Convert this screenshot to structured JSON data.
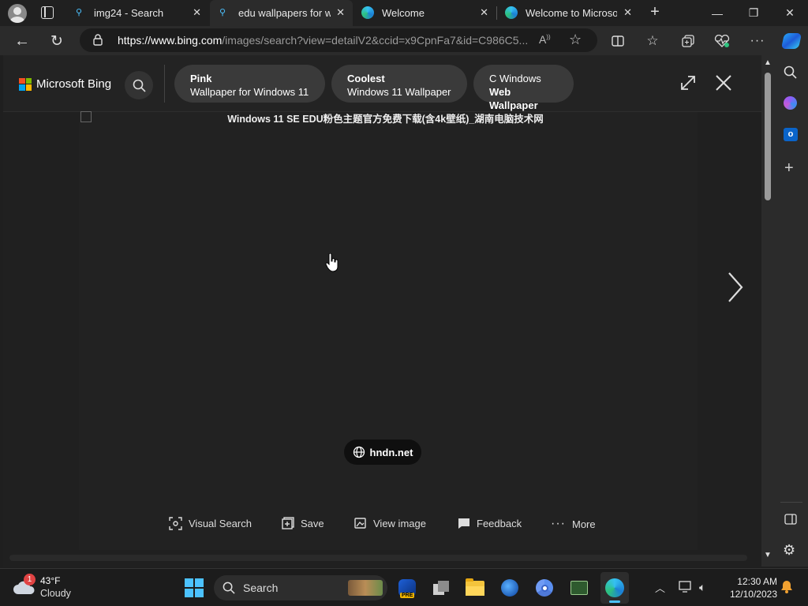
{
  "browser": {
    "tabs": [
      {
        "title": "img24 - Search",
        "active": false
      },
      {
        "title": "edu wallpapers for wi",
        "active": true
      },
      {
        "title": "Welcome",
        "active": false
      },
      {
        "title": "Welcome to Microsoft",
        "active": false
      }
    ],
    "url_domain": "https://www.bing.com",
    "url_rest": "/images/search?view=detailV2&ccid=x9CpnFa7&id=C986C5..."
  },
  "bing": {
    "brand": "Microsoft Bing",
    "chips": [
      {
        "line1": "Pink",
        "line2": "Wallpaper for Windows 11",
        "bold_line": 1
      },
      {
        "line1": "Coolest",
        "line2": "Windows 11 Wallpaper",
        "bold_line": 1
      },
      {
        "line1": "C Windows",
        "line2": "Web Wallpaper",
        "bold_line": 2
      }
    ],
    "image_caption": "Windows 11 SE EDU粉色主题官方免费下载(含4k壁纸)_湖南电脑技术网",
    "source": "hndn.net",
    "actions": {
      "visual_search": "Visual Search",
      "save": "Save",
      "view_image": "View image",
      "feedback": "Feedback",
      "more": "More"
    }
  },
  "taskbar": {
    "weather_temp": "43°F",
    "weather_desc": "Cloudy",
    "weather_badge": "1",
    "search_label": "Search",
    "time": "12:30 AM",
    "date": "12/10/2023"
  },
  "colors": {
    "accent_blue": "#4cc2ff",
    "ms_red": "#f25022",
    "ms_green": "#7fba00",
    "ms_blue": "#00a4ef",
    "ms_yellow": "#ffb900"
  }
}
